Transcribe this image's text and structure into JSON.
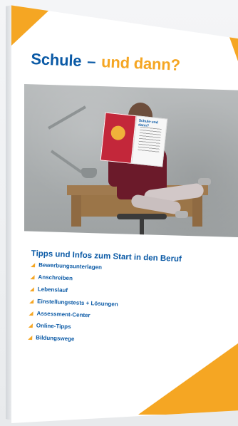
{
  "brochure": {
    "title_part1": "Schule",
    "title_dash": "–",
    "title_part2": "und dann?",
    "cover_image_alt": "Woman reading a brochure at a wooden desk",
    "magazine_logo": "Schule·und dann?",
    "section_heading": "Tipps und Infos zum Start in den Beruf",
    "items": [
      {
        "label": "Bewerbungsunterlagen"
      },
      {
        "label": "Anschreiben"
      },
      {
        "label": "Lebenslauf"
      },
      {
        "label": "Einstellungstests + Lösungen"
      },
      {
        "label": "Assessment-Center"
      },
      {
        "label": "Online-Tipps"
      },
      {
        "label": "Bildungswege"
      }
    ]
  },
  "colors": {
    "accent_orange": "#f5a623",
    "brand_blue": "#0b5aa6",
    "background": "#f2f3f5"
  }
}
